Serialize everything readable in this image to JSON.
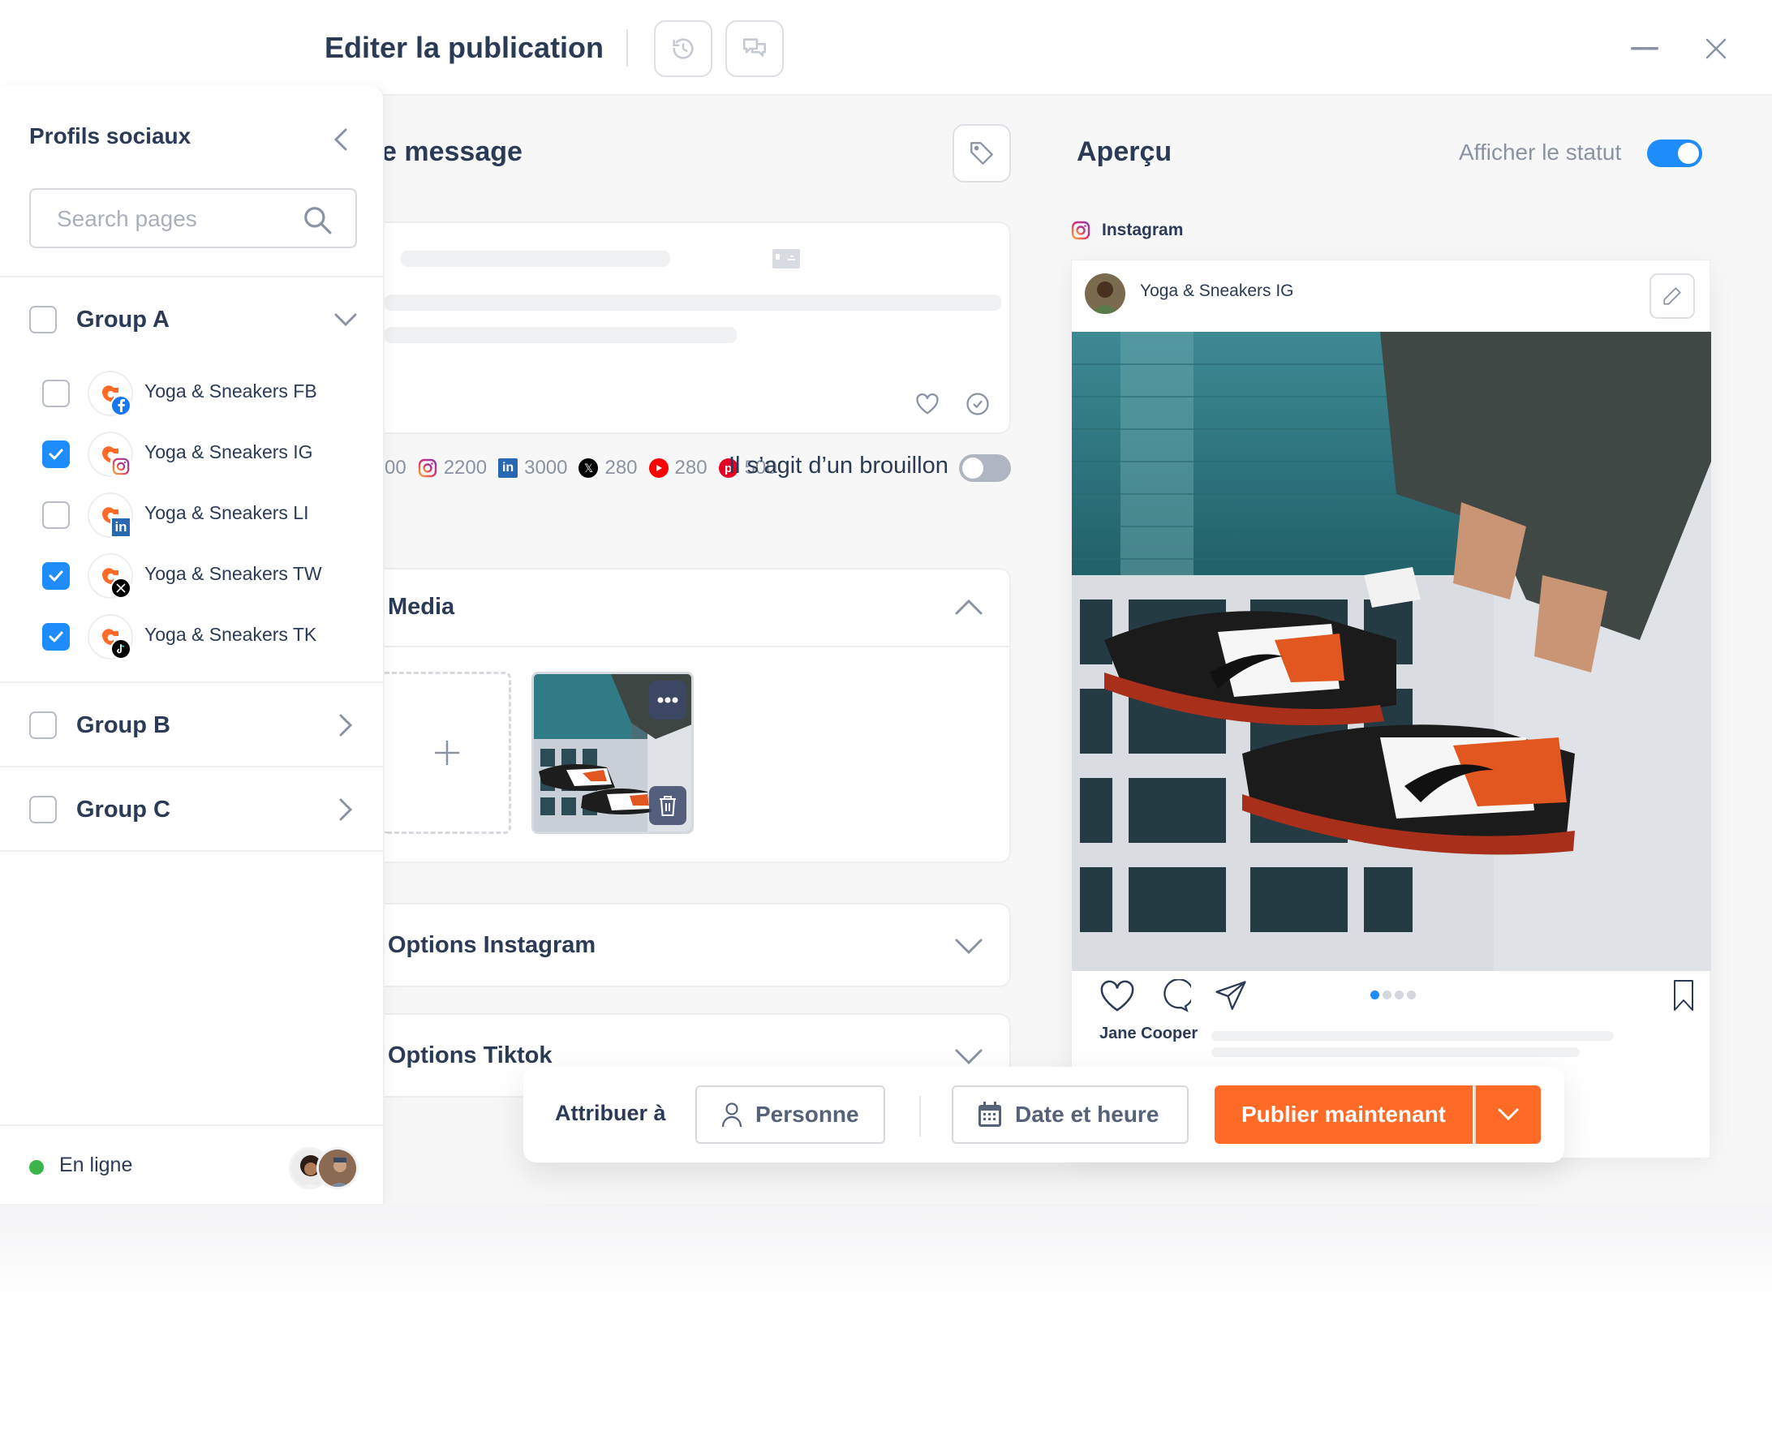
{
  "header": {
    "title": "Editer la publication",
    "history_icon": "history-icon",
    "comments_icon": "comments-icon",
    "minimize_icon": "minimize-icon",
    "close_icon": "close-icon"
  },
  "sidebar": {
    "title": "Profils sociaux",
    "collapse_icon": "chevron-left-icon",
    "search": {
      "placeholder": "Search pages",
      "value": ""
    },
    "groups": [
      {
        "label": "Group A",
        "checked": false,
        "expanded": true,
        "profiles": [
          {
            "label": "Yoga & Sneakers FB",
            "network": "facebook",
            "checked": false
          },
          {
            "label": "Yoga & Sneakers IG",
            "network": "instagram",
            "checked": true
          },
          {
            "label": "Yoga & Sneakers LI",
            "network": "linkedin",
            "checked": false
          },
          {
            "label": "Yoga & Sneakers TW",
            "network": "x",
            "checked": true
          },
          {
            "label": "Yoga & Sneakers TK",
            "network": "tiktok",
            "checked": true
          }
        ]
      },
      {
        "label": "Group B",
        "checked": false,
        "expanded": false
      },
      {
        "label": "Group C",
        "checked": false,
        "expanded": false
      }
    ],
    "footer": {
      "status": "En ligne",
      "status_color": "#3bb54a",
      "viewer_count": 2
    }
  },
  "compose": {
    "title": "e message",
    "tag_icon": "tag-icon",
    "counters": [
      {
        "network": "facebook",
        "value": "00"
      },
      {
        "network": "instagram",
        "value": "2200"
      },
      {
        "network": "linkedin",
        "value": "3000"
      },
      {
        "network": "x",
        "value": "280"
      },
      {
        "network": "youtube",
        "value": "280"
      },
      {
        "network": "pinterest",
        "value": "500"
      }
    ],
    "draft": {
      "label": "Il s’agit d’un brouillon",
      "on": false
    },
    "sections": {
      "media": {
        "title": "Media",
        "expanded": true
      },
      "instagram": {
        "title": "Options Instagram",
        "expanded": false
      },
      "tiktok": {
        "title": "Options Tiktok",
        "expanded": false
      }
    }
  },
  "preview": {
    "title": "Aperçu",
    "status_label": "Afficher le statut",
    "status_on": true,
    "network": "Instagram",
    "account_name": "Yoga & Sneakers IG",
    "caption_user": "Jane Cooper",
    "carousel": {
      "count": 4,
      "active": 1
    }
  },
  "action_bar": {
    "assign_label": "Attribuer à",
    "assignee": "Personne",
    "date_label": "Date et heure",
    "publish_label": "Publier maintenant"
  },
  "colors": {
    "accent": "#1e8cfa",
    "publish": "#ff6a26",
    "text": "#2b3a55",
    "muted": "#8a93a3"
  }
}
